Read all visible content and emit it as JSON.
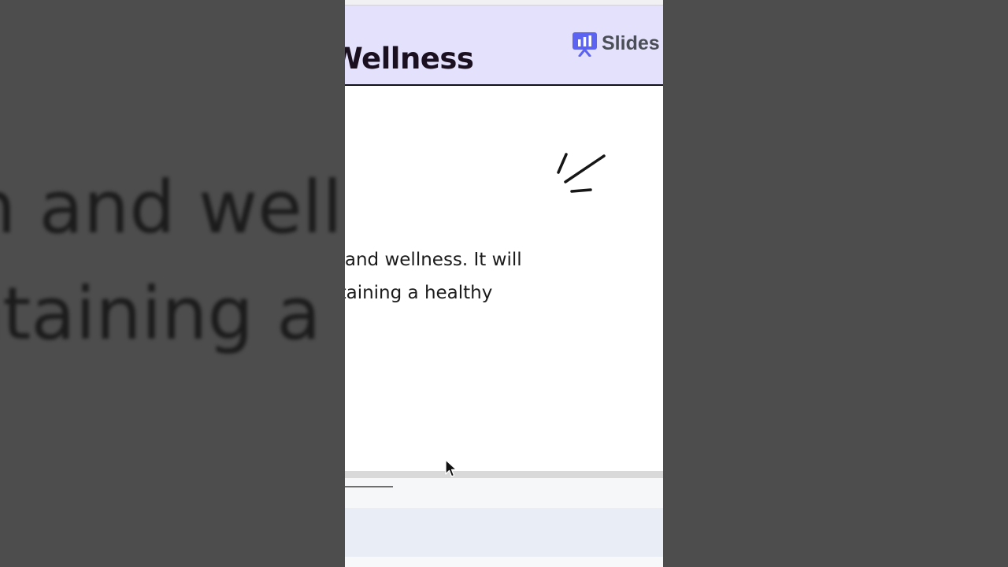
{
  "background_copy": {
    "line1": "n and welln",
    "line2": "ntaining a h"
  },
  "slide": {
    "title": "Wellness",
    "brand_name": "Slides",
    "body_line1": "n and wellness. It will",
    "body_line2": "ntaining a healthy"
  },
  "colors": {
    "header_bg": "#e3e1fb",
    "brand_icon": "#5b63f0",
    "side_bg": "#4d4d4d"
  },
  "icons": {
    "brand": "presentation-chart-icon",
    "accent": "sparkle-lines-icon",
    "pointer": "mouse-cursor-icon"
  }
}
